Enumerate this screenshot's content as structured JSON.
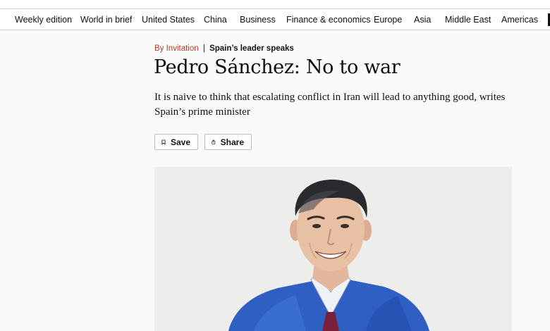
{
  "nav": {
    "items": [
      "Weekly edition",
      "World in brief",
      "United States",
      "China",
      "Business",
      "Finance & economics",
      "Europe",
      "Asia",
      "Middle East",
      "Americas"
    ]
  },
  "article": {
    "rubric_label": "By Invitation",
    "rubric_separator": "|",
    "rubric_topic": "Spain’s leader speaks",
    "headline": "Pedro Sánchez: No to war",
    "standfirst": "It is naive to think that escalating conflict in Iran will lead to anything good, writes Spain’s prime minister"
  },
  "actions": {
    "save_label": "Save",
    "share_label": "Share"
  },
  "colors": {
    "accent_red": "#c0392b",
    "text": "#0d0d0d",
    "suit_blue": "#2f5fc2"
  },
  "icons": [
    "bookmark-icon",
    "share-icon"
  ]
}
